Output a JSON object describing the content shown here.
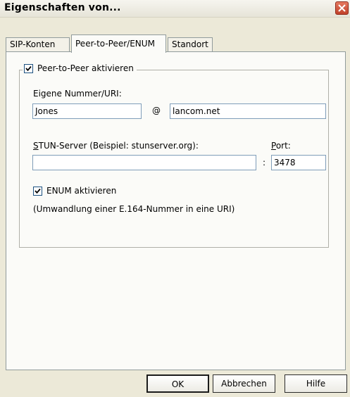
{
  "window": {
    "title": "Eigenschaften von..."
  },
  "tabs": [
    {
      "label": "SIP-Konten"
    },
    {
      "label": "Peer-to-Peer/ENUM"
    },
    {
      "label": "Standort"
    }
  ],
  "p2p": {
    "group_label": "Peer-to-Peer aktivieren",
    "checked": true,
    "own_number_label": "Eigene Nummer/URI:",
    "user_value": "Jones",
    "at_sign": "@",
    "domain_value": "lancom.net",
    "stun_label_first": "S",
    "stun_label_rest": "TUN-Server (Beispiel: stunserver.org):",
    "stun_value": "",
    "port_label_first": "P",
    "port_label_rest": "ort:",
    "colon": ":",
    "port_value": "3478",
    "enum_label": "ENUM aktivieren",
    "enum_checked": true,
    "enum_note": "(Umwandlung einer E.164-Nummer in eine URI)"
  },
  "buttons": {
    "ok": "OK",
    "cancel": "Abbrechen",
    "help": "Hilfe"
  }
}
